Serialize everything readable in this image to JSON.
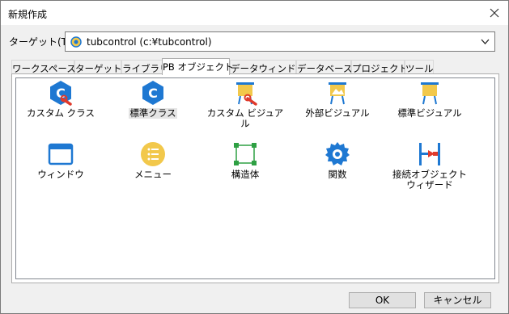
{
  "window": {
    "title": "新規作成"
  },
  "target": {
    "label": "ターゲット(T):",
    "value": "tubcontrol (c:¥tubcontrol)"
  },
  "tabs": [
    "ワークスペース",
    "ターゲット",
    "ライブラリ",
    "PB オブジェクト",
    "データウィンドウ",
    "データベース",
    "プロジェクト",
    "ツール"
  ],
  "active_tab": "PB オブジェクト",
  "items": [
    {
      "label": "カスタム クラス",
      "icon": "custom-class-icon"
    },
    {
      "label": "標準クラス",
      "icon": "standard-class-icon"
    },
    {
      "label": "カスタム ビジュアル",
      "icon": "custom-visual-icon"
    },
    {
      "label": "外部ビジュアル",
      "icon": "external-visual-icon"
    },
    {
      "label": "標準ビジュアル",
      "icon": "standard-visual-icon"
    },
    {
      "label": "ウィンドウ",
      "icon": "window-icon"
    },
    {
      "label": "メニュー",
      "icon": "menu-icon"
    },
    {
      "label": "構造体",
      "icon": "structure-icon"
    },
    {
      "label": "関数",
      "icon": "function-icon"
    },
    {
      "label": "接続オブジェクト\nウィザード",
      "icon": "connection-wizard-icon"
    }
  ],
  "buttons": {
    "ok": "OK",
    "cancel": "キャンセル"
  },
  "colors": {
    "blue": "#1e78d2",
    "yellow": "#f2c84b",
    "red": "#e03a2c",
    "green": "#2ea043"
  }
}
